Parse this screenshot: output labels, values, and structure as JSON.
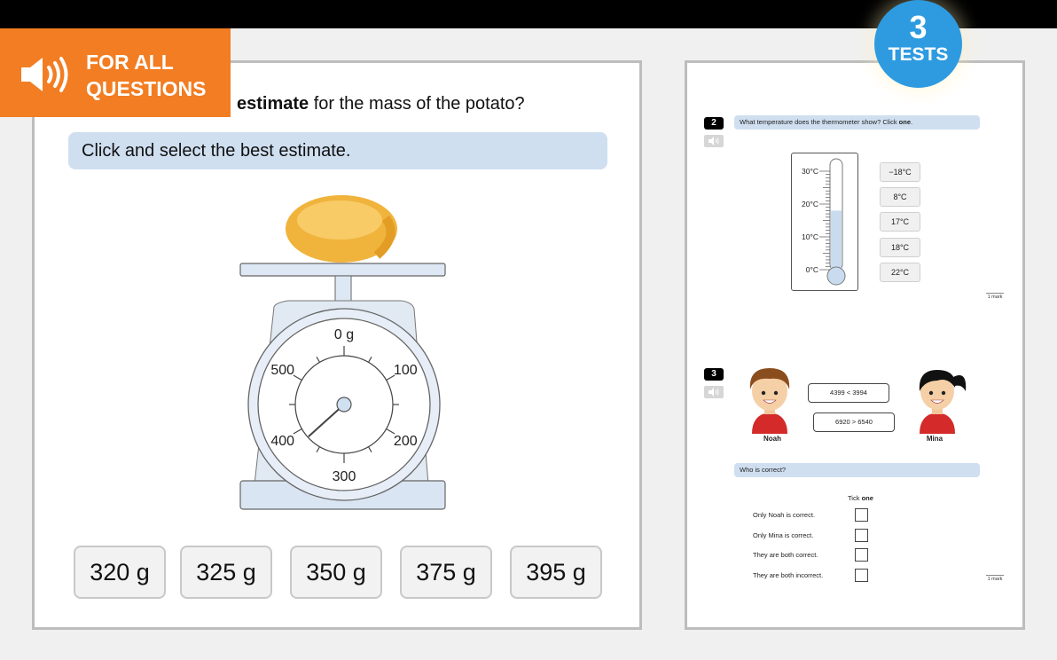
{
  "audio_banner": {
    "line1": "FOR ALL",
    "line2": "QUESTIONS",
    "icon": "speaker-icon"
  },
  "badge": {
    "number": "3",
    "word": "TESTS"
  },
  "left_panel": {
    "question_bold": "estimate",
    "question_rest": " for the mass of the potato?",
    "instruction": "Click and select the best estimate.",
    "scale": {
      "dial_labels": [
        "0 g",
        "100",
        "200",
        "300",
        "400",
        "500"
      ],
      "dial_max_g": 600,
      "needle_reading_g": 380
    },
    "choices": [
      "320 g",
      "325 g",
      "350 g",
      "375 g",
      "395 g"
    ]
  },
  "right_panel": {
    "q2": {
      "number": "2",
      "prompt": "What temperature does the thermometer show? Click ",
      "prompt_bold": "one",
      "prompt_end": ".",
      "thermometer_labels": [
        "30°C",
        "20°C",
        "10°C",
        "0°C"
      ],
      "thermometer_reading_c": 18,
      "options": [
        "−18°C",
        "8°C",
        "17°C",
        "18°C",
        "22°C"
      ],
      "mark": "1 mark"
    },
    "q3": {
      "number": "3",
      "noah_says": "4399 < 3994",
      "mina_says": "6920 > 6540",
      "noah_name": "Noah",
      "mina_name": "Mina",
      "prompt": "Who is correct?",
      "tick_label": "Tick ",
      "tick_bold": "one",
      "options": [
        "Only Noah is correct.",
        "Only Mina is correct.",
        "They are both correct.",
        "They are both incorrect."
      ],
      "mark": "1 mark"
    }
  }
}
